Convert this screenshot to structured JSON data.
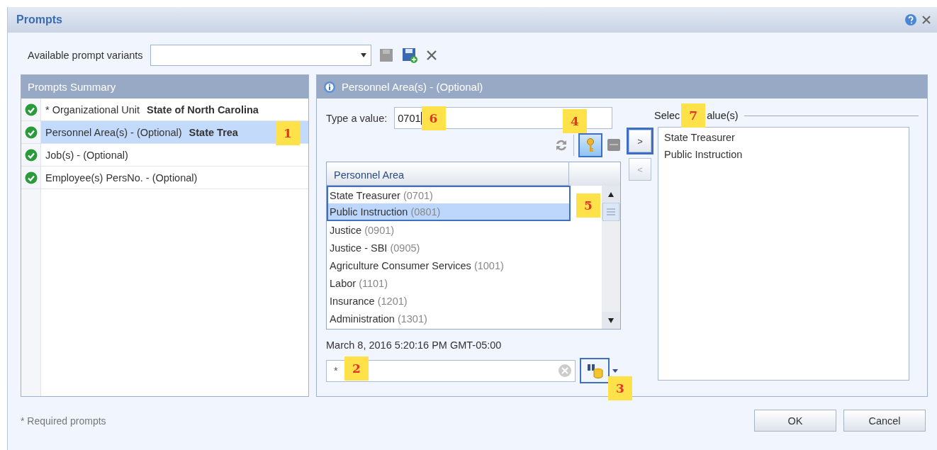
{
  "window": {
    "title": "Prompts"
  },
  "variants": {
    "label": "Available prompt variants"
  },
  "summary": {
    "title": "Prompts Summary",
    "items": [
      {
        "label": "* Organizational Unit",
        "value": "State of North Carolina",
        "selected": false
      },
      {
        "label": "Personnel Area(s) - (Optional)",
        "value": "State Trea",
        "selected": true,
        "callout": "1"
      },
      {
        "label": "Job(s) - (Optional)",
        "selected": false
      },
      {
        "label": "Employee(s) PersNo. - (Optional)",
        "selected": false
      }
    ]
  },
  "prompt": {
    "title": "Personnel Area(s) - (Optional)",
    "type_label": "Type a value:",
    "type_value": "0701",
    "type_callout": "6",
    "toolbar": {
      "callout": "4",
      "key_pressed": true,
      "key_outlined": true
    },
    "table": {
      "columns": [
        "Personnel Area"
      ],
      "callout": "5",
      "rows": [
        {
          "name": "State Treasurer",
          "key": "(0701)",
          "selected": false,
          "outlined": true
        },
        {
          "name": "Public Instruction",
          "key": "(0801)",
          "selected": true,
          "outlined": true
        },
        {
          "name": "Justice",
          "key": "(0901)",
          "selected": false,
          "outlined": false
        },
        {
          "name": "Justice - SBI",
          "key": "(0905)",
          "selected": false,
          "outlined": false
        },
        {
          "name": "Agriculture Consumer Services",
          "key": "(1001)",
          "selected": false,
          "outlined": false
        },
        {
          "name": "Labor",
          "key": "(1101)",
          "selected": false,
          "outlined": false
        },
        {
          "name": "Insurance",
          "key": "(1201)",
          "selected": false,
          "outlined": false
        },
        {
          "name": "Administration",
          "key": "(1301)",
          "selected": false,
          "outlined": false
        }
      ]
    },
    "date": "March 8, 2016 5:20:16 PM GMT-05:00",
    "search": {
      "value": "*",
      "callout": "2"
    },
    "search_button": {
      "outlined": true,
      "callout": "3"
    },
    "selected_legend": [
      "Selec",
      "alue(s)"
    ],
    "legend_callout": "7",
    "add_button": {
      "label": ">",
      "outlined": true
    },
    "remove_button": {
      "label": "<",
      "outlined": false
    },
    "selected_values": [
      "State Treasurer",
      "Public Instruction"
    ]
  },
  "footer": {
    "note": "* Required prompts",
    "buttons": [
      "OK",
      "Cancel"
    ]
  }
}
